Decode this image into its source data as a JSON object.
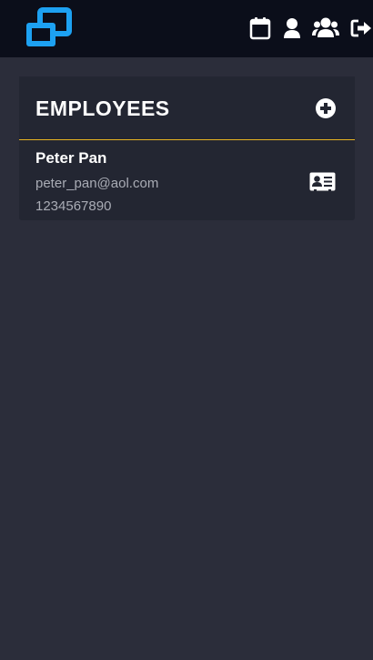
{
  "app": {
    "logo_icon": "windows-logo-icon",
    "accent_color": "#1da1f2"
  },
  "nav": {
    "icons": [
      "calendar-icon",
      "user-icon",
      "users-group-icon",
      "sign-out-icon"
    ]
  },
  "employees": {
    "title": "EMPLOYEES",
    "add_icon": "plus-circle-icon",
    "divider_color": "#e6b422",
    "items": [
      {
        "name": "Peter Pan",
        "email": "peter_pan@aol.com",
        "phone": "1234567890",
        "action_icon": "contact-card-icon"
      }
    ]
  }
}
